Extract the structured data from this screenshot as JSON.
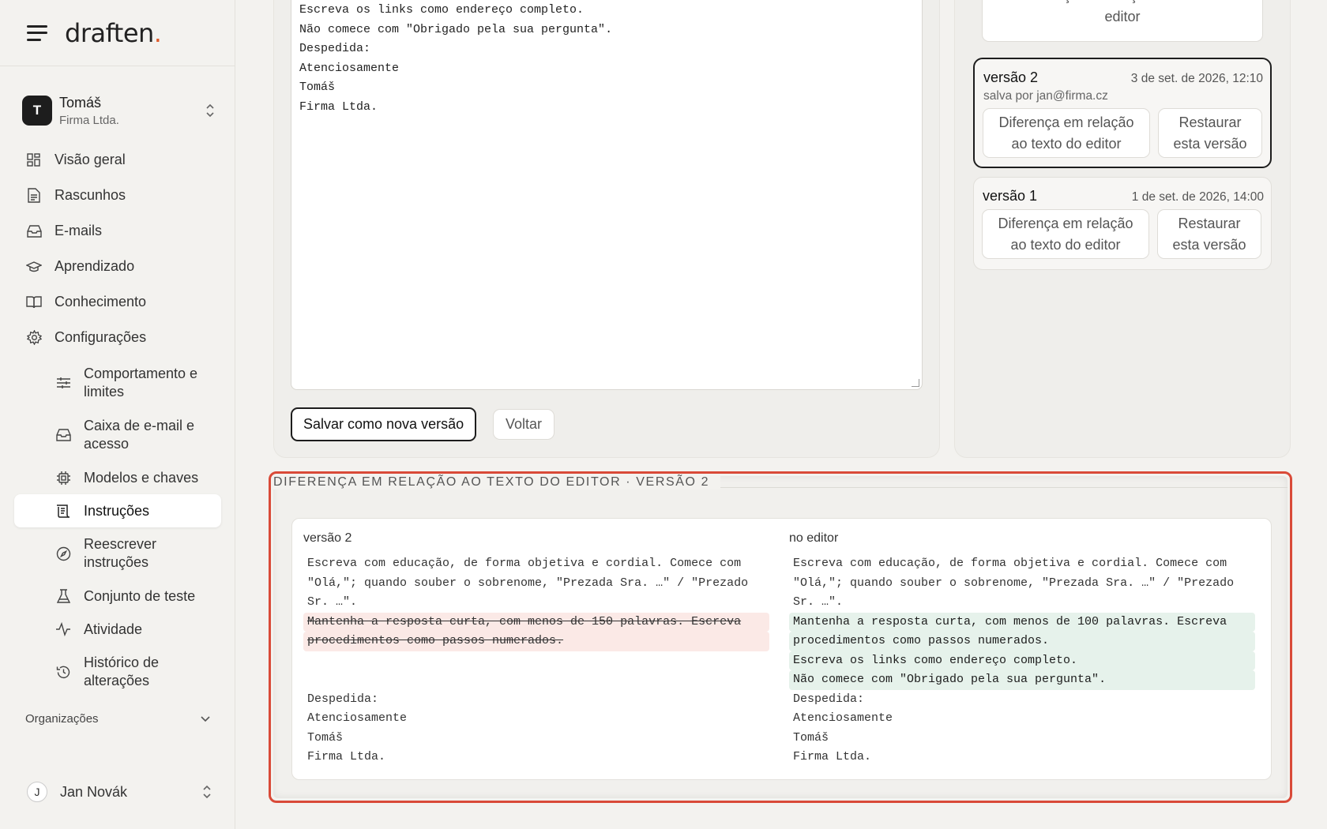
{
  "brand": {
    "name": "draften",
    "dot": "."
  },
  "org": {
    "initial": "T",
    "name": "Tomáš",
    "company": "Firma Ltda."
  },
  "nav": {
    "items": [
      {
        "label": "Visão geral",
        "icon": "grid-icon"
      },
      {
        "label": "Rascunhos",
        "icon": "document-icon"
      },
      {
        "label": "E-mails",
        "icon": "inbox-icon"
      },
      {
        "label": "Aprendizado",
        "icon": "graduation-cap-icon"
      },
      {
        "label": "Conhecimento",
        "icon": "book-icon"
      },
      {
        "label": "Configurações",
        "icon": "gear-icon"
      }
    ],
    "sub_items": [
      {
        "label": "Comportamento e limites",
        "icon": "sliders-icon"
      },
      {
        "label": "Caixa de e-mail e acesso",
        "icon": "inbox-icon"
      },
      {
        "label": "Modelos e chaves",
        "icon": "chip-icon"
      },
      {
        "label": "Instruções",
        "icon": "scroll-icon",
        "active": true
      },
      {
        "label": "Reescrever instruções",
        "icon": "compass-icon"
      },
      {
        "label": "Conjunto de teste",
        "icon": "flask-icon"
      },
      {
        "label": "Atividade",
        "icon": "activity-icon"
      },
      {
        "label": "Histórico de alterações",
        "icon": "history-icon"
      }
    ]
  },
  "organizations_label": "Organizações",
  "user": {
    "initial": "J",
    "name": "Jan Novák"
  },
  "editor": {
    "lines": [
      "Escreva os links como endereço completo.",
      "Não comece com \"Obrigado pela sua pergunta\".",
      "Despedida:",
      "Atenciosamente",
      "Tomáš",
      "Firma Ltda."
    ],
    "save_label": "Salvar como nova versão",
    "back_label": "Voltar"
  },
  "versions": {
    "top_diff_label": "Diferença em relação ao texto do editor",
    "items": [
      {
        "name": "versão 2",
        "date": "3 de set. de 2026, 12:10",
        "saved_by": "salva por jan@firma.cz",
        "diff_label": "Diferença em relação ao texto do editor",
        "restore_label": "Restaurar esta versão",
        "selected": true
      },
      {
        "name": "versão 1",
        "date": "1 de set. de 2026, 14:00",
        "saved_by": "",
        "diff_label": "Diferença em relação ao texto do editor",
        "restore_label": "Restaurar esta versão",
        "selected": false
      }
    ]
  },
  "diff": {
    "title": "DIFERENÇA EM RELAÇÃO AO TEXTO DO EDITOR · VERSÃO 2",
    "left_label": "versão 2",
    "right_label": "no editor",
    "left": {
      "common_top": [
        "Escreva com educação, de forma objetiva e cordial. Comece com",
        "\"Olá,\"; quando souber o sobrenome, \"Prezada Sra. …\" / \"Prezado",
        "Sr. …\"."
      ],
      "removed": [
        "Mantenha a resposta curta, com menos de 150 palavras. Escreva",
        "procedimentos como passos numerados."
      ],
      "common_bottom": [
        "Despedida:",
        "Atenciosamente",
        "Tomáš",
        "Firma Ltda."
      ]
    },
    "right": {
      "common_top": [
        "Escreva com educação, de forma objetiva e cordial. Comece com",
        "\"Olá,\"; quando souber o sobrenome, \"Prezada Sra. …\" / \"Prezado",
        "Sr. …\"."
      ],
      "added": [
        "Mantenha a resposta curta, com menos de 100 palavras. Escreva",
        "procedimentos como passos numerados.",
        "Escreva os links como endereço completo.",
        "Não comece com \"Obrigado pela sua pergunta\"."
      ],
      "common_bottom": [
        "Despedida:",
        "Atenciosamente",
        "Tomáš",
        "Firma Ltda."
      ]
    }
  },
  "colors": {
    "accent": "#e05a2a",
    "highlight_outline": "#d94a38",
    "removed_bg": "#fbe9e6",
    "added_bg": "#e6f2eb"
  }
}
